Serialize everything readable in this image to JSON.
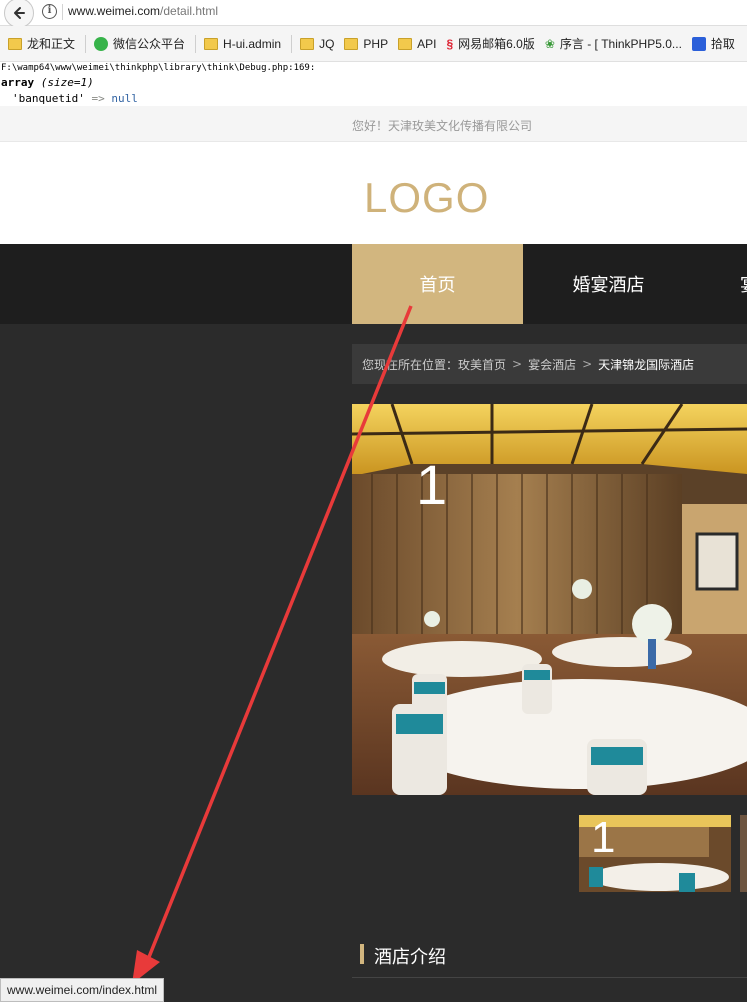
{
  "browser": {
    "url_host": "www.weimei.com",
    "url_path": "/detail.html",
    "bookmarks": [
      {
        "label": "龙和正文",
        "icon": "folder-icon"
      },
      {
        "label": "微信公众平台",
        "icon": "wechat-icon"
      },
      {
        "label": "H-ui.admin",
        "icon": "folder-icon"
      },
      {
        "label": "JQ",
        "icon": "folder-icon"
      },
      {
        "label": "PHP",
        "icon": "folder-icon"
      },
      {
        "label": "API",
        "icon": "folder-icon"
      },
      {
        "label": "网易邮箱6.0版",
        "icon": "mail-icon"
      },
      {
        "label": "序言 - [ ThinkPHP5.0...",
        "icon": "leaf-icon"
      },
      {
        "label": "拾取",
        "icon": "paw-icon"
      }
    ],
    "status_url": "www.weimei.com/index.html"
  },
  "debug": {
    "path": "F:\\wamp64\\www\\weimei\\thinkphp\\library\\think\\Debug.php:169:",
    "array_word": "array",
    "size_text": "(size=1)",
    "key": "'banquetid'",
    "arrow": "=>",
    "value": "null"
  },
  "site": {
    "greeting": "您好！天津玫美文化传播有限公司",
    "logo": "LOGO",
    "nav": {
      "home": "首页",
      "banquet": "婚宴酒店",
      "more": "宴"
    },
    "breadcrumb": {
      "prefix": "您现在所在位置：",
      "items": [
        "玫美首页",
        "宴会酒店",
        "天津锦龙国际酒店"
      ],
      "separator": ">"
    },
    "gallery": {
      "slide_number": "1",
      "thumb_number": "1"
    },
    "section_title": "酒店介绍"
  },
  "colors": {
    "accent": "#d2b67f",
    "logo": "#cfb27a",
    "annotation": "#e83a3a"
  }
}
